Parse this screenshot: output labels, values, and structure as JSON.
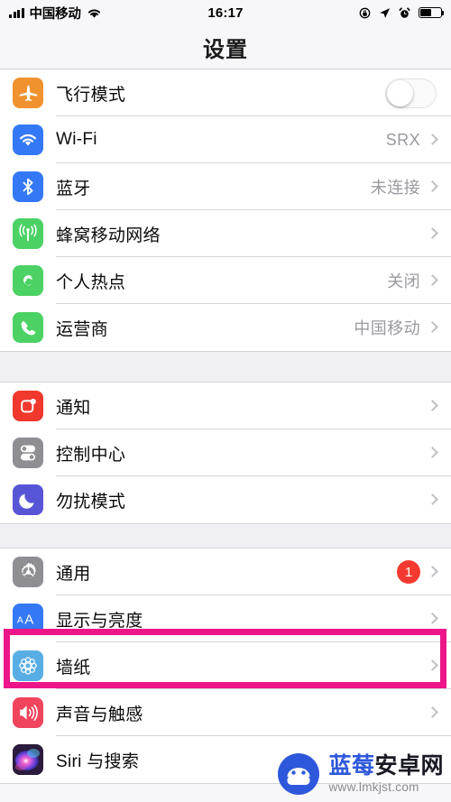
{
  "statusbar": {
    "carrier": "中国移动",
    "time": "16:17",
    "signal_icon": "signal-bars-icon",
    "wifi_icon": "wifi-icon",
    "rotation_lock_icon": "rotation-lock-icon",
    "location_icon": "location-arrow-icon",
    "alarm_icon": "alarm-clock-icon",
    "battery_icon": "battery-icon",
    "battery_level": 55
  },
  "header": {
    "title": "设置"
  },
  "groups": [
    {
      "id": "connectivity",
      "rows": [
        {
          "label": "飞行模式",
          "icon": "airplane-icon",
          "icon_color": "#F0922E",
          "control": "toggle",
          "toggle_on": false
        },
        {
          "label": "Wi-Fi",
          "icon": "wifi-icon",
          "icon_color": "#3478F6",
          "value": "SRX",
          "control": "chevron"
        },
        {
          "label": "蓝牙",
          "icon": "bluetooth-icon",
          "icon_color": "#3478F6",
          "value": "未连接",
          "control": "chevron"
        },
        {
          "label": "蜂窝移动网络",
          "icon": "cellular-antenna-icon",
          "icon_color": "#4CD264",
          "value": "",
          "control": "chevron"
        },
        {
          "label": "个人热点",
          "icon": "hotspot-link-icon",
          "icon_color": "#4CD264",
          "value": "关闭",
          "control": "chevron"
        },
        {
          "label": "运营商",
          "icon": "phone-icon",
          "icon_color": "#4CD264",
          "value": "中国移动",
          "control": "chevron"
        }
      ]
    },
    {
      "id": "notifications",
      "rows": [
        {
          "label": "通知",
          "icon": "notification-icon",
          "icon_color": "#F0392C",
          "value": "",
          "control": "chevron"
        },
        {
          "label": "控制中心",
          "icon": "control-center-icon",
          "icon_color": "#8E8E93",
          "value": "",
          "control": "chevron"
        },
        {
          "label": "勿扰模式",
          "icon": "moon-icon",
          "icon_color": "#5755D6",
          "value": "",
          "control": "chevron"
        }
      ]
    },
    {
      "id": "system",
      "rows": [
        {
          "label": "通用",
          "icon": "gear-icon",
          "icon_color": "#8E8E93",
          "badge": "1",
          "control": "chevron"
        },
        {
          "label": "显示与亮度",
          "icon": "display-brightness-aa-icon",
          "icon_color": "#3478F6",
          "value": "",
          "control": "chevron",
          "highlighted": true
        },
        {
          "label": "墙纸",
          "icon": "wallpaper-flower-icon",
          "icon_color": "#58AEE4",
          "value": "",
          "control": "chevron"
        },
        {
          "label": "声音与触感",
          "icon": "speaker-icon",
          "icon_color": "#F0435C",
          "value": "",
          "control": "chevron"
        },
        {
          "label": "Siri 与搜索",
          "icon": "siri-icon",
          "icon_color": "#2B1B3C",
          "value": "",
          "control": "chevron"
        }
      ]
    }
  ],
  "highlight": {
    "color": "#EC1589",
    "target_label": "显示与亮度"
  },
  "watermark": {
    "brand_blue": "蓝莓",
    "brand_dark": "安卓网",
    "url": "www.lmkjst.com",
    "logo_icon": "android-mascot-icon",
    "logo_color": "#2E58DB"
  }
}
